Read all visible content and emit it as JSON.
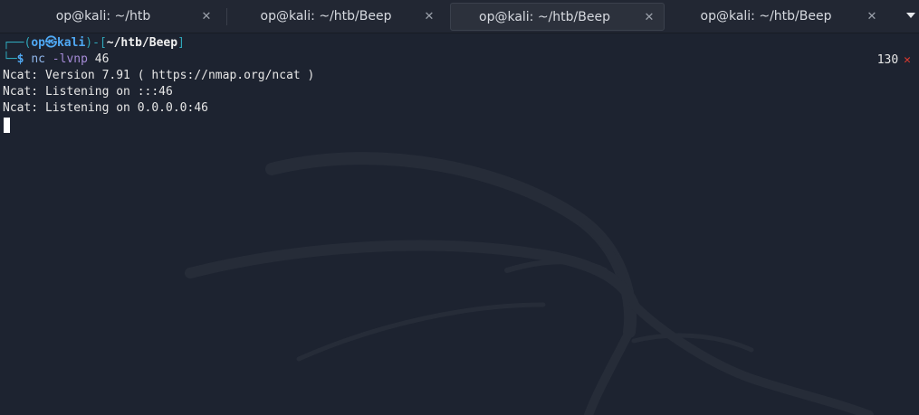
{
  "tabs": [
    {
      "label": "op@kali: ~/htb",
      "active": false
    },
    {
      "label": "op@kali: ~/htb/Beep",
      "active": false
    },
    {
      "label": "op@kali: ~/htb/Beep",
      "active": true
    },
    {
      "label": "op@kali: ~/htb/Beep",
      "active": false
    }
  ],
  "tab_close_glyph": "✕",
  "prompt": {
    "frame_top": "┌──(",
    "user": "op",
    "at_glyph": "㉿",
    "host": "kali",
    "mid": ")-[",
    "path": "~/htb/Beep",
    "close": "]",
    "frame_bottom": "└─",
    "dollar": "$",
    "command": "nc",
    "option": "-lvnp",
    "argument": "46"
  },
  "status": {
    "exit_code": "130",
    "error_glyph": "✕"
  },
  "output_lines": [
    "Ncat: Version 7.91 ( https://nmap.org/ncat )",
    "Ncat: Listening on :::46",
    "Ncat: Listening on 0.0.0.0:46"
  ],
  "colors": {
    "background": "#1d2330",
    "prompt_frame": "#2fa6b9",
    "prompt_user": "#4fa8f3",
    "command": "#8fb5ea",
    "option": "#a58bd7",
    "error": "#e0392e"
  }
}
